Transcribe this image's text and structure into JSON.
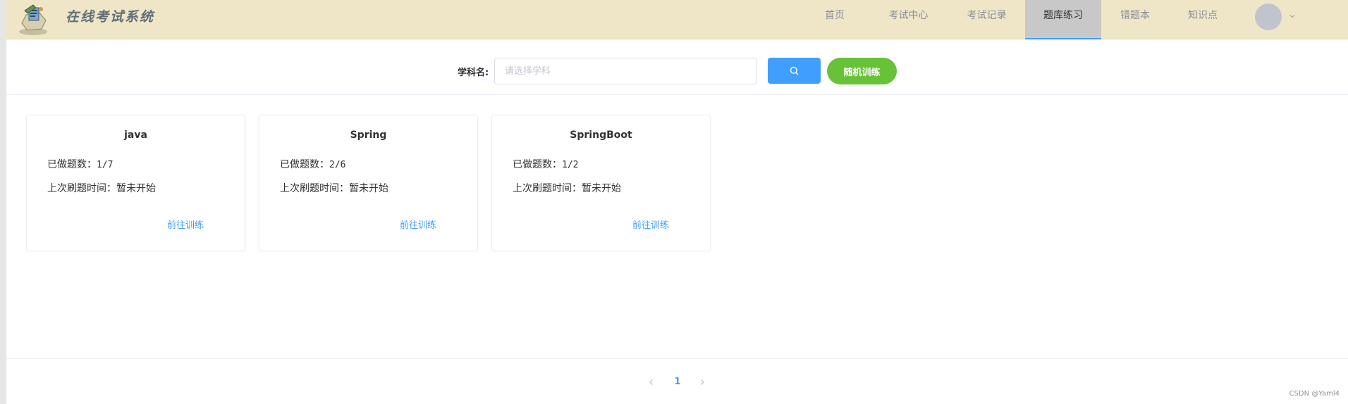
{
  "header": {
    "app_title": "在线考试系统",
    "nav": [
      {
        "label": "首页",
        "active": false
      },
      {
        "label": "考试中心",
        "active": false
      },
      {
        "label": "考试记录",
        "active": false
      },
      {
        "label": "题库练习",
        "active": true
      },
      {
        "label": "错题本",
        "active": false
      },
      {
        "label": "知识点",
        "active": false
      }
    ]
  },
  "search": {
    "label": "学科名:",
    "placeholder": "请选择学科",
    "value": "",
    "random_button": "随机训练"
  },
  "cards": [
    {
      "title": "java",
      "done_label": "已做题数：",
      "done_value": "1/7",
      "last_label": "上次刷题时间：",
      "last_value": "暂未开始",
      "link": "前往训练"
    },
    {
      "title": "Spring",
      "done_label": "已做题数：",
      "done_value": "2/6",
      "last_label": "上次刷题时间：",
      "last_value": "暂未开始",
      "link": "前往训练"
    },
    {
      "title": "SpringBoot",
      "done_label": "已做题数：",
      "done_value": "1/2",
      "last_label": "上次刷题时间：",
      "last_value": "暂未开始",
      "link": "前往训练"
    }
  ],
  "pagination": {
    "current": "1"
  },
  "watermark": "CSDN @Yaml4",
  "colors": {
    "header_bg": "#efe6c8",
    "primary": "#409eff",
    "success": "#67c23a"
  }
}
